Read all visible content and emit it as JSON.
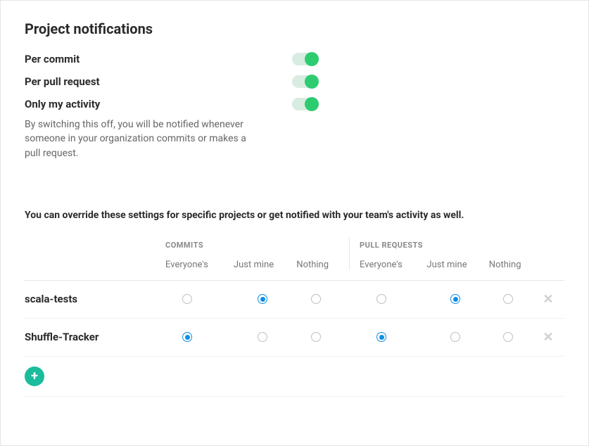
{
  "title": "Project notifications",
  "toggles": {
    "per_commit": {
      "label": "Per commit",
      "on": true
    },
    "per_pull_request": {
      "label": "Per pull request",
      "on": true
    },
    "only_my_activity": {
      "label": "Only my activity",
      "on": true,
      "help": "By switching this off, you will be notified whenever someone in your organization commits or makes a pull request."
    }
  },
  "override_note": "You can override these settings for specific projects or get notified with your team's activity as well.",
  "columns": {
    "commits": {
      "title": "COMMITS",
      "options": [
        "Everyone's",
        "Just mine",
        "Nothing"
      ]
    },
    "pull_requests": {
      "title": "PULL REQUESTS",
      "options": [
        "Everyone's",
        "Just mine",
        "Nothing"
      ]
    }
  },
  "projects": [
    {
      "name": "scala-tests",
      "commits": "Just mine",
      "pull_requests": "Just mine"
    },
    {
      "name": "Shuffle-Tracker",
      "commits": "Everyone's",
      "pull_requests": "Everyone's"
    }
  ]
}
